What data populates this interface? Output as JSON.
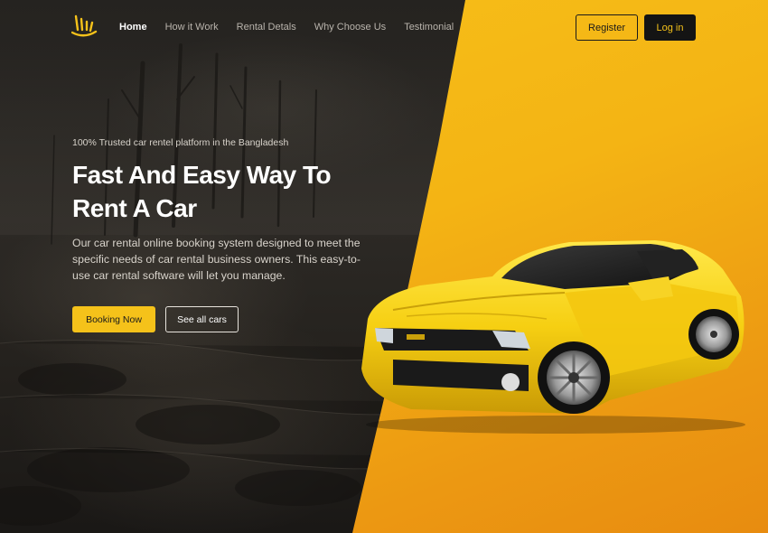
{
  "nav": {
    "items": [
      {
        "label": "Home",
        "active": true
      },
      {
        "label": "How it Work",
        "active": false
      },
      {
        "label": "Rental Detals",
        "active": false
      },
      {
        "label": "Why Choose Us",
        "active": false
      },
      {
        "label": "Testimonial",
        "active": false
      }
    ],
    "register_label": "Register",
    "login_label": "Log in"
  },
  "hero": {
    "tagline": "100% Trusted car rentel platform in the Bangladesh",
    "headline": "Fast And Easy Way To Rent A Car",
    "description": "Our car rental  online booking system designed to meet the specific needs of car rental business owners. This easy-to-use car rental software will let you manage.",
    "primary_button": "Booking Now",
    "secondary_button": "See all cars"
  },
  "colors": {
    "accent": "#f5c21a",
    "dark": "#141414",
    "background": "#2a2723"
  },
  "icons": {
    "logo": "hand-logo-icon",
    "car": "yellow-sports-car-image"
  }
}
